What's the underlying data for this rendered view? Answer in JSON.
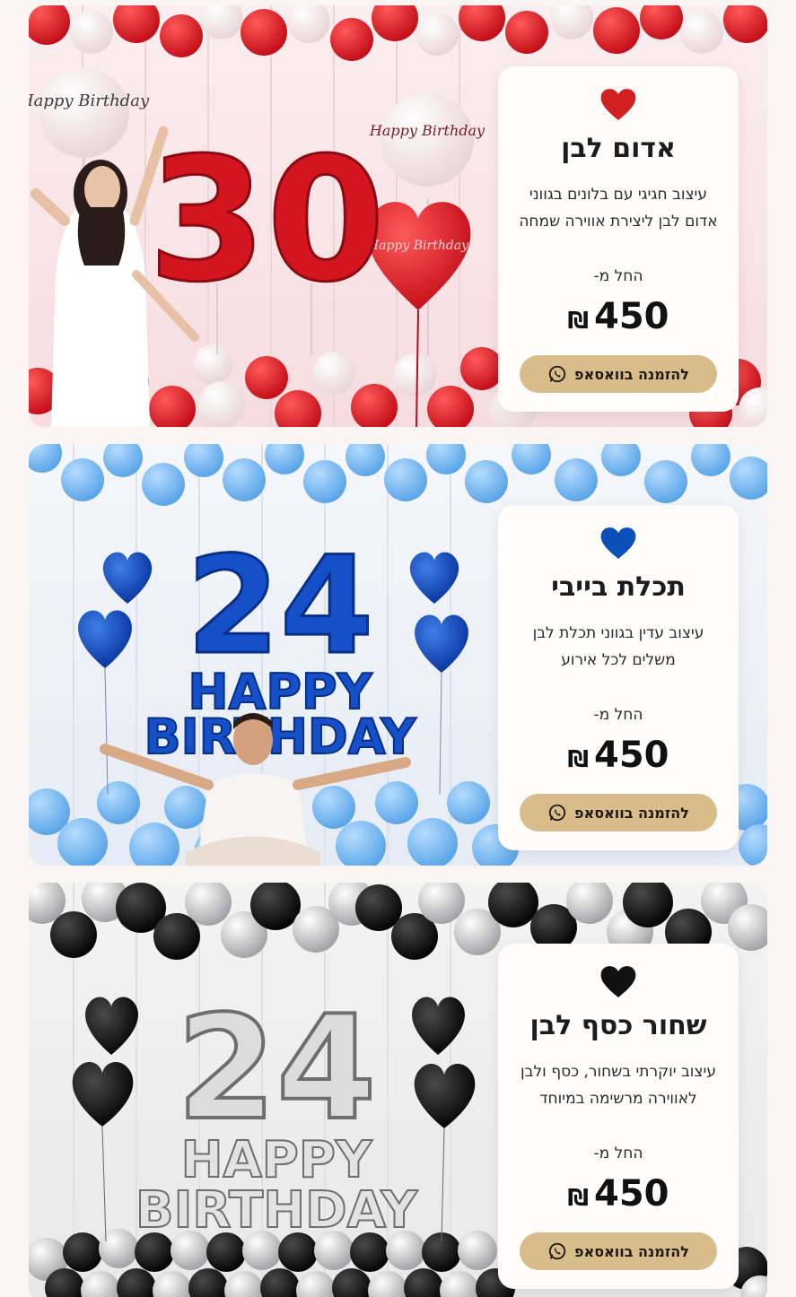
{
  "cards": [
    {
      "title": "אדום לבן",
      "description": "עיצוב חגיגי עם בלונים בגווני אדום לבן ליצירת אווירה שמחה",
      "from_label": "החל מ-",
      "price": "450",
      "currency": "₪",
      "button_label": "להזמנה בוואסאפ",
      "heart_color": "#d0201f",
      "scene_texts": {
        "number": "30",
        "balloon_text_1": "Happy Birthday",
        "balloon_text_2": "Happy Birthday",
        "balloon_text_3": "Happy Birthday"
      }
    },
    {
      "title": "תכלת בייבי",
      "description": "עיצוב עדין בגווני תכלת לבן משלים לכל אירוע",
      "from_label": "החל מ-",
      "price": "450",
      "currency": "₪",
      "button_label": "להזמנה בוואסאפ",
      "heart_color": "#0b4fb8",
      "scene_texts": {
        "number": "24",
        "line1": "HAPPY",
        "line2": "BIRTHDAY"
      }
    },
    {
      "title": "שחור כסף לבן",
      "description": "עיצוב יוקרתי בשחור, כסף ולבן לאווירה מרשימה במיוחד",
      "from_label": "החל מ-",
      "price": "450",
      "currency": "₪",
      "button_label": "להזמנה בוואסאפ",
      "heart_color": "#111111",
      "scene_texts": {
        "number": "24",
        "line1": "HAPPY",
        "line2": "BIRTHDAY"
      }
    }
  ],
  "colors": {
    "page_bg": "#faf5f2",
    "button_bg": "#d8bd8a",
    "card_bg": "#fffdfb"
  }
}
